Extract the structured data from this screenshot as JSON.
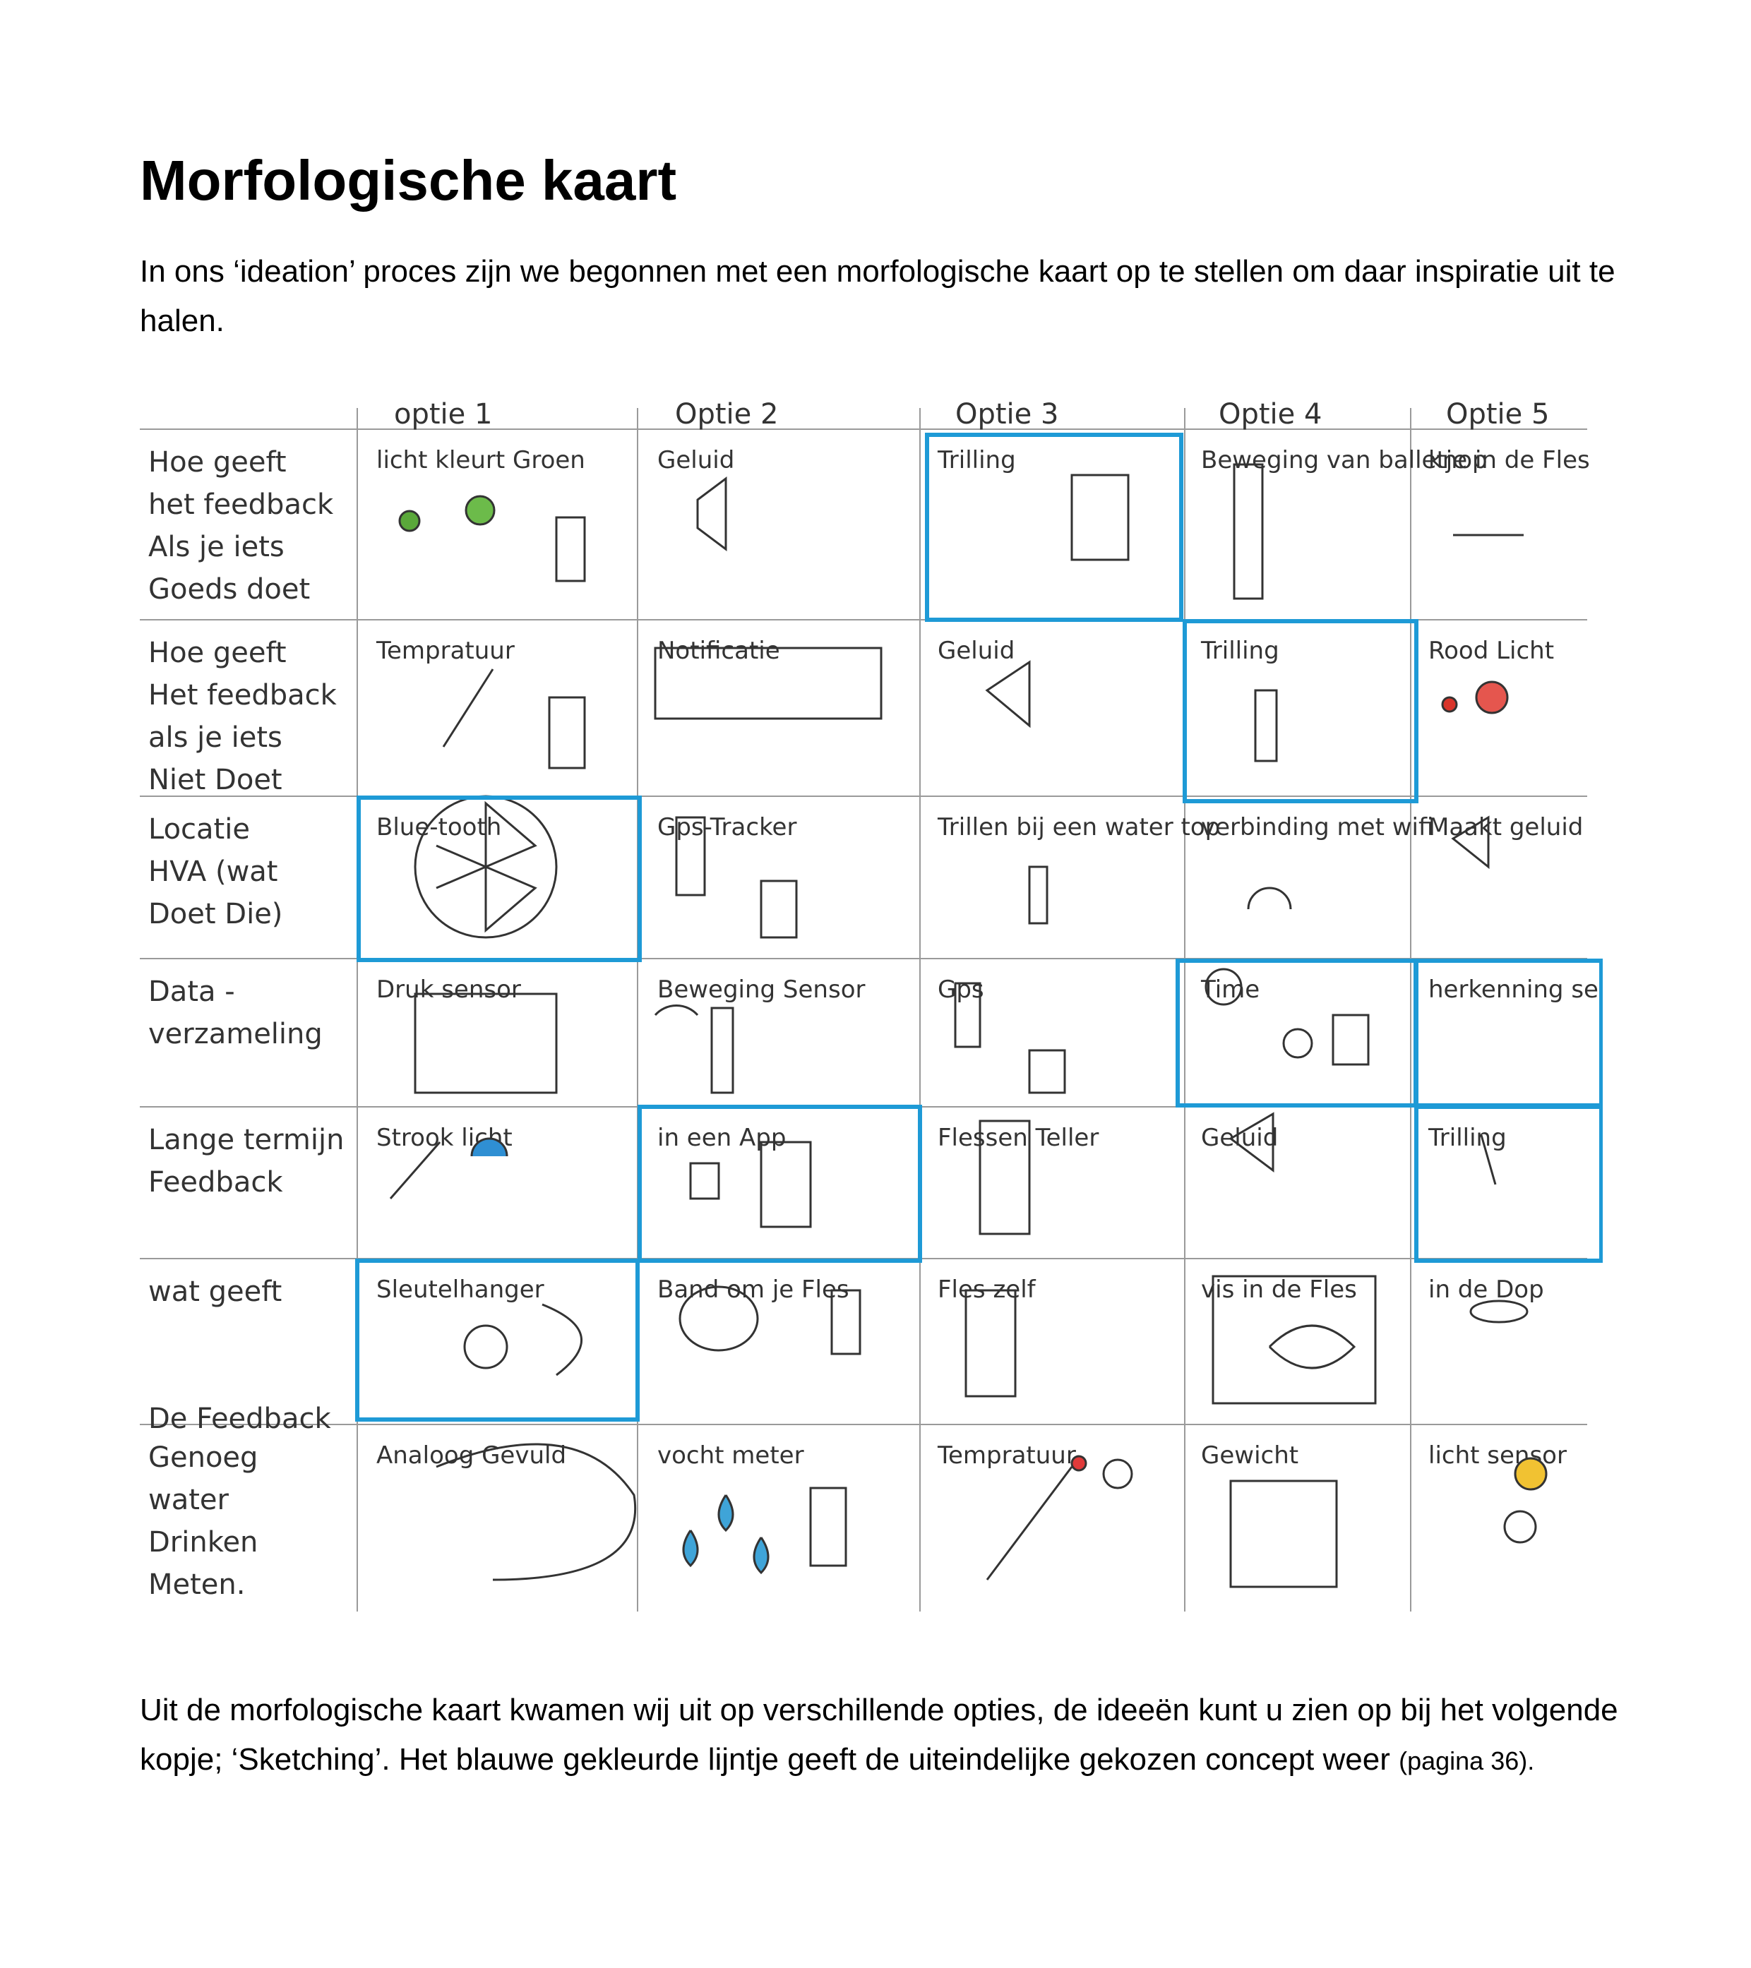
{
  "title": "Morfologische kaart",
  "intro": "In ons ‘ideation’ proces zijn we begonnen met een morfologische kaart op te stellen om daar inspiratie uit te halen.",
  "outro": {
    "main": "Uit de morfologische kaart kwamen wij uit op verschillende opties, de ideeën kunt u zien op bij het volgende kopje; ‘Sketching’. Het blauwe gekleurde lijntje geeft de uiteindelijke gekozen concept weer",
    "page_ref": "(pagina 36)."
  },
  "sketch": {
    "options": [
      "optie 1",
      "Optie 2",
      "Optie 3",
      "Optie 4",
      "Optie 5"
    ],
    "rows": [
      {
        "label": [
          "Hoe geeft",
          "het feedback",
          "Als je iets",
          "Goeds doet"
        ],
        "cells": [
          "licht kleurt Groen",
          "Geluid",
          "Trilling",
          "Beweging van balletje in de Fles",
          "knop"
        ]
      },
      {
        "label": [
          "Hoe geeft",
          "Het feedback",
          "als je iets",
          "Niet Doet"
        ],
        "cells": [
          "Tempratuur",
          "Notificatie",
          "Geluid",
          "Trilling",
          "Rood Licht"
        ]
      },
      {
        "label": [
          "Locatie",
          "HVA (wat",
          "Doet Die)"
        ],
        "cells": [
          "Blue-tooth",
          "Gps-Tracker",
          "Trillen bij een water top",
          "verbinding met wifi",
          "Maakt geluid"
        ]
      },
      {
        "label": [
          "Data -",
          "verzameling"
        ],
        "cells": [
          "Druk sensor",
          "Beweging Sensor",
          "Gps",
          "Time",
          "herkenning sensor"
        ]
      },
      {
        "label": [
          "Lange termijn",
          "Feedback"
        ],
        "cells": [
          "Strook licht",
          "in een App",
          "Flessen Teller",
          "Geluid",
          "Trilling"
        ]
      },
      {
        "label": [
          "wat geeft",
          "",
          "",
          "De Feedback"
        ],
        "cells": [
          "Sleutelhanger",
          "Band om je Fles",
          "Fles zelf",
          "vis in de Fles",
          "in de Dop"
        ]
      },
      {
        "label": [
          "Genoeg",
          "water",
          "Drinken",
          "Meten."
        ],
        "cells": [
          "Analoog Gevuld",
          "vocht meter",
          "Tempratuur",
          "Gewicht",
          "licht sensor"
        ]
      }
    ],
    "highlight_color": "#1e9ad6",
    "line_color": "#999999"
  }
}
